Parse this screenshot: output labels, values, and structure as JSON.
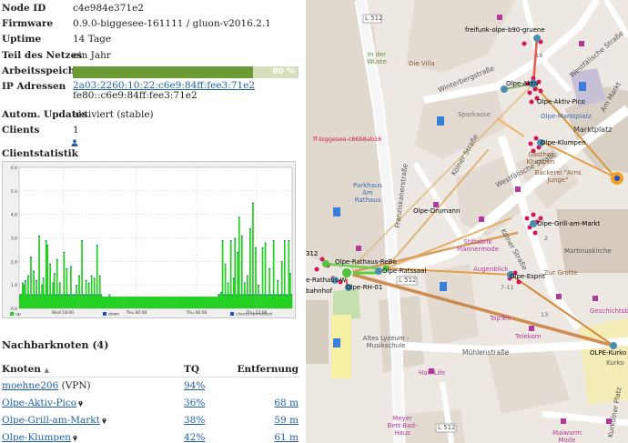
{
  "node": {
    "rows": [
      {
        "key": "Node ID",
        "value": "c4e984e371e2"
      },
      {
        "key": "Firmware",
        "value": "0.9.0-biggesee-161111 / gluon-v2016.2.1"
      },
      {
        "key": "Uptime",
        "value": "14 Tage"
      },
      {
        "key": "Teil des Netzes",
        "value": "ein Jahr"
      }
    ],
    "memory": {
      "key": "Arbeitsspeicher",
      "percent": 80,
      "label": "80 %"
    },
    "ip": {
      "key": "IP Adressen",
      "values": [
        "2a03:2260:10:22:c6e9:84ff:fee3:71e2",
        "fe80::c6e9:84ff:fee3:71e2"
      ]
    },
    "updates": {
      "key": "Autom. Updates",
      "value": "aktiviert (stable)"
    },
    "clients": {
      "key": "Clients",
      "value": "1"
    }
  },
  "stats": {
    "title": "Clientstatistik"
  },
  "chart_data": {
    "type": "area",
    "ylim": [
      0,
      6
    ],
    "yticks": [
      "0.0",
      "1.0",
      "2.0",
      "3.0",
      "4.0",
      "5.0",
      "6.0"
    ],
    "xticks": [
      "Wed 18:00",
      "Thu 00:00",
      "Thu 06:00",
      "Thu 12:00"
    ],
    "legend": [
      "up",
      "down",
      "clients connected"
    ],
    "colors": {
      "up": "#22d020",
      "down": "#1f4fd0",
      "clients": "#1f4fd0"
    },
    "values": [
      0.6,
      0.6,
      1.1,
      1.0,
      1.2,
      0.6,
      1.4,
      0.6,
      2.2,
      0.6,
      1.6,
      0.6,
      1.2,
      0.6,
      3.1,
      0.6,
      1.0,
      1.3,
      0.6,
      2.9,
      2.7,
      0.6,
      1.9,
      0.6,
      1.1,
      1.5,
      0.6,
      2.1,
      0.6,
      1.1,
      0.6,
      0.6,
      2.4,
      0.6,
      1.7,
      0.6,
      0.6,
      1.8,
      0.6,
      0.6,
      0.6,
      1.0,
      0.6,
      1.4,
      0.6,
      2.9,
      0.6,
      0.6,
      1.2,
      0.6,
      1.1,
      0.6,
      1.4,
      0.6,
      1.3,
      0.6,
      2.7,
      0.6,
      1.4,
      0.6,
      0.5,
      0.5,
      0.5,
      0.5,
      0.5,
      0.6,
      0.5,
      0.5,
      0.5,
      0.5,
      0.5,
      0.5,
      0.5,
      0.5,
      0.5,
      0.5,
      0.5,
      0.5,
      0.5,
      0.5,
      0.5,
      0.5,
      0.5,
      0.5,
      0.5,
      0.5,
      0.5,
      0.5,
      0.5,
      0.5,
      0.5,
      0.5,
      0.5,
      0.5,
      0.5,
      0.5,
      0.5,
      0.5,
      0.5,
      0.5,
      0.5,
      0.5,
      0.5,
      0.5,
      0.5,
      0.5,
      0.5,
      0.5,
      0.5,
      0.5,
      0.5,
      0.5,
      0.5,
      0.5,
      0.5,
      0.5,
      0.5,
      0.5,
      0.5,
      0.5,
      0.5,
      0.5,
      0.5,
      0.5,
      0.5,
      0.5,
      0.5,
      0.5,
      0.5,
      0.5,
      0.5,
      0.5,
      0.5,
      0.5,
      0.5,
      0.5,
      0.5,
      0.5,
      0.5,
      0.5,
      0.5,
      0.5,
      0.5,
      0.5,
      0.6,
      0.6,
      0.7,
      2.9,
      0.6,
      1.9,
      0.6,
      1.1,
      0.6,
      2.9,
      0.6,
      1.3,
      3.0,
      0.6,
      2.4,
      3.9,
      0.6,
      3.1,
      0.6,
      1.1,
      0.6,
      1.4,
      0.6,
      3.4,
      0.6,
      4.5,
      0.6,
      2.6,
      0.6,
      1.0,
      0.6,
      0.6,
      2.6,
      0.6,
      2.8,
      0.6,
      0.6,
      1.7,
      0.6,
      0.6,
      2.9,
      0.6,
      0.6,
      1.2,
      0.6,
      0.6,
      2.0,
      0.6,
      2.9,
      0.6,
      0.6,
      2.9,
      1.5,
      0.6
    ]
  },
  "neighbours": {
    "title": "Nachbarknoten (4)",
    "headers": {
      "node": "Knoten",
      "tq": "TQ",
      "distance": "Entfernung"
    },
    "rows": [
      {
        "name": "moehne206",
        "suffix": "(VPN)",
        "tq": "94%",
        "distance": "",
        "pin": false
      },
      {
        "name": "Olpe-Aktiv-Pico",
        "suffix": "",
        "tq": "36%",
        "distance": "68 m",
        "pin": true
      },
      {
        "name": "Olpe-Grill-am-Markt",
        "suffix": "",
        "tq": "38%",
        "distance": "59 m",
        "pin": true
      },
      {
        "name": "Olpe-Klumpen",
        "suffix": "",
        "tq": "42%",
        "distance": "61 m",
        "pin": true
      }
    ]
  },
  "map": {
    "streets": [
      {
        "text": "L 512"
      },
      {
        "text": "Winterbergstraße"
      },
      {
        "text": "Westfälische Straße"
      },
      {
        "text": "Kölner Straße"
      },
      {
        "text": "Mühlenstraße"
      },
      {
        "text": "Franziskanerstraße"
      },
      {
        "text": "Am Markt"
      },
      {
        "text": "Kurkölner Platz"
      }
    ],
    "pois": [
      {
        "text": "In der Wüste"
      },
      {
        "text": "Die Villa"
      },
      {
        "text": "Sparkasse"
      },
      {
        "text": "Marktplatz"
      },
      {
        "text": "Parkhaus Am Rathaus"
      },
      {
        "text": "Stiftsbrik Männermode"
      },
      {
        "text": "Augenblick"
      },
      {
        "text": "Gasthof Klumpen"
      },
      {
        "text": "Bäckerei \"Arns Junge\""
      },
      {
        "text": "Martinuskirche"
      },
      {
        "text": "Zur Grotte"
      },
      {
        "text": "Geschichtsbrunnen"
      },
      {
        "text": "Altes Lyzeum - Musikschule"
      },
      {
        "text": "TopTen"
      },
      {
        "text": "Telekom"
      },
      {
        "text": "Hair Life"
      },
      {
        "text": "Meyer Bett-Bad-Haus"
      },
      {
        "text": "Maiwarm Mode"
      },
      {
        "text": "Kurko"
      }
    ],
    "nodes": [
      {
        "text": "freifunk-olpe-b90-gruene"
      },
      {
        "text": "Olpe-Aktiv"
      },
      {
        "text": "Olpe-Aktiv-Pico"
      },
      {
        "text": "Olpe-Marktplatz"
      },
      {
        "text": "Olpe-Klumpen"
      },
      {
        "text": "Olpe-Drumann"
      },
      {
        "text": "Olpe-Grill-am-Markt"
      },
      {
        "text": "Olpe-Rathaus-ReBo"
      },
      {
        "text": "Olpe-Ratssaal"
      },
      {
        "text": "e-Rathaus-W"
      },
      {
        "text": "Olpe-RH-01"
      },
      {
        "text": "bahnhof"
      },
      {
        "text": "Olpe-Esprit"
      },
      {
        "text": "OLPE-Kurko"
      },
      {
        "text": "ff-biggesee-c86b8ab16"
      },
      {
        "text": "312"
      }
    ],
    "house_numbers": [
      {
        "text": "18"
      },
      {
        "text": "7-11"
      },
      {
        "text": "13"
      },
      {
        "text": "2"
      }
    ]
  }
}
